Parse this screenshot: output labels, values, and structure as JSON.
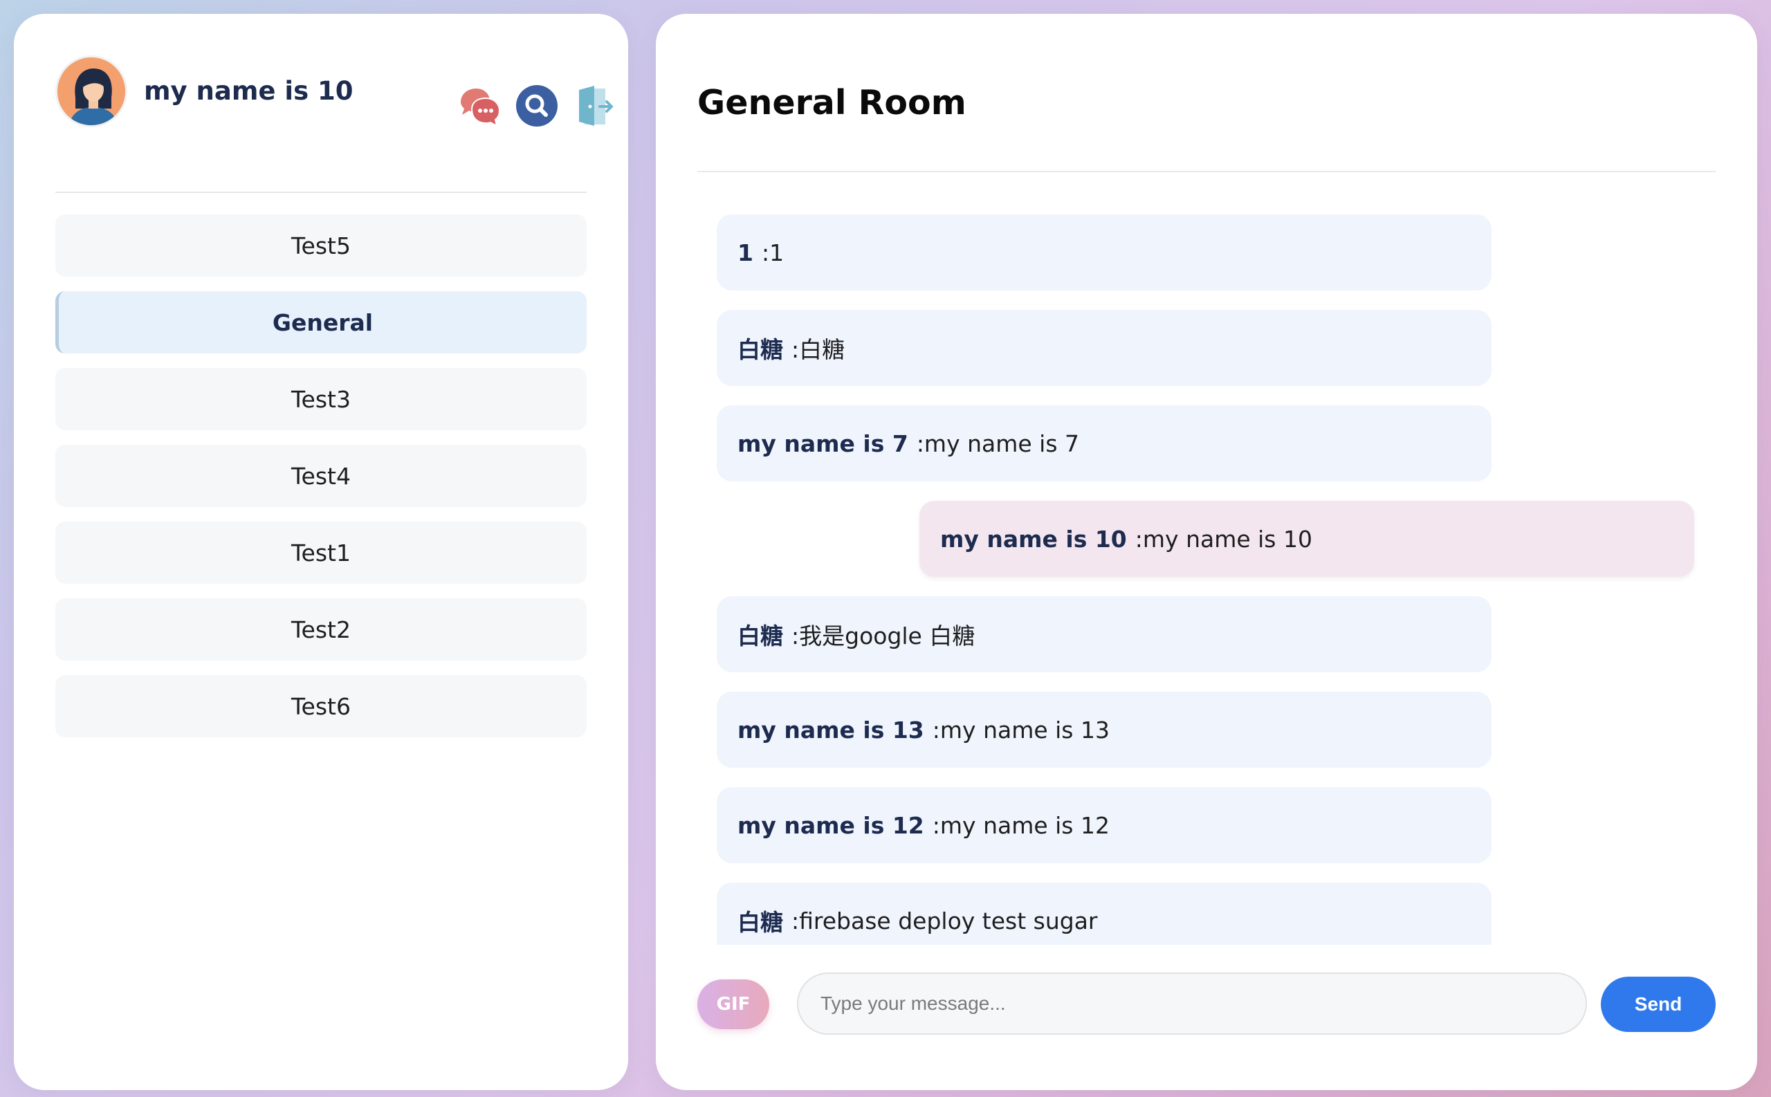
{
  "user": {
    "name": "my name is 10"
  },
  "header_icons": [
    {
      "name": "chat-bubbles-icon"
    },
    {
      "name": "search-icon"
    },
    {
      "name": "logout-door-icon"
    }
  ],
  "rooms": [
    {
      "label": "Test5",
      "active": false
    },
    {
      "label": "General",
      "active": true
    },
    {
      "label": "Test3",
      "active": false
    },
    {
      "label": "Test4",
      "active": false
    },
    {
      "label": "Test1",
      "active": false
    },
    {
      "label": "Test2",
      "active": false
    },
    {
      "label": "Test6",
      "active": false
    }
  ],
  "chat": {
    "title": "General Room",
    "messages": [
      {
        "sender": "1",
        "text": ":1",
        "mine": false
      },
      {
        "sender": "白糖",
        "text": ":白糖",
        "mine": false
      },
      {
        "sender": "my name is 7",
        "text": ":my name is 7",
        "mine": false
      },
      {
        "sender": "my name is 10",
        "text": ":my name is 10",
        "mine": true
      },
      {
        "sender": "白糖",
        "text": ":我是google 白糖",
        "mine": false
      },
      {
        "sender": "my name is 13",
        "text": ":my name is 13",
        "mine": false
      },
      {
        "sender": "my name is 12",
        "text": ":my name is 12",
        "mine": false
      },
      {
        "sender": "白糖",
        "text": ":firebase deploy test sugar",
        "mine": false
      }
    ]
  },
  "composer": {
    "gif_label": "GIF",
    "placeholder": "Type your message...",
    "value": "",
    "send_label": "Send"
  },
  "colors": {
    "accent": "#2f79ec",
    "own_message_bg": "#f3e6ef",
    "other_message_bg": "#eff4fd",
    "active_room_bg": "#e7f1fb"
  }
}
